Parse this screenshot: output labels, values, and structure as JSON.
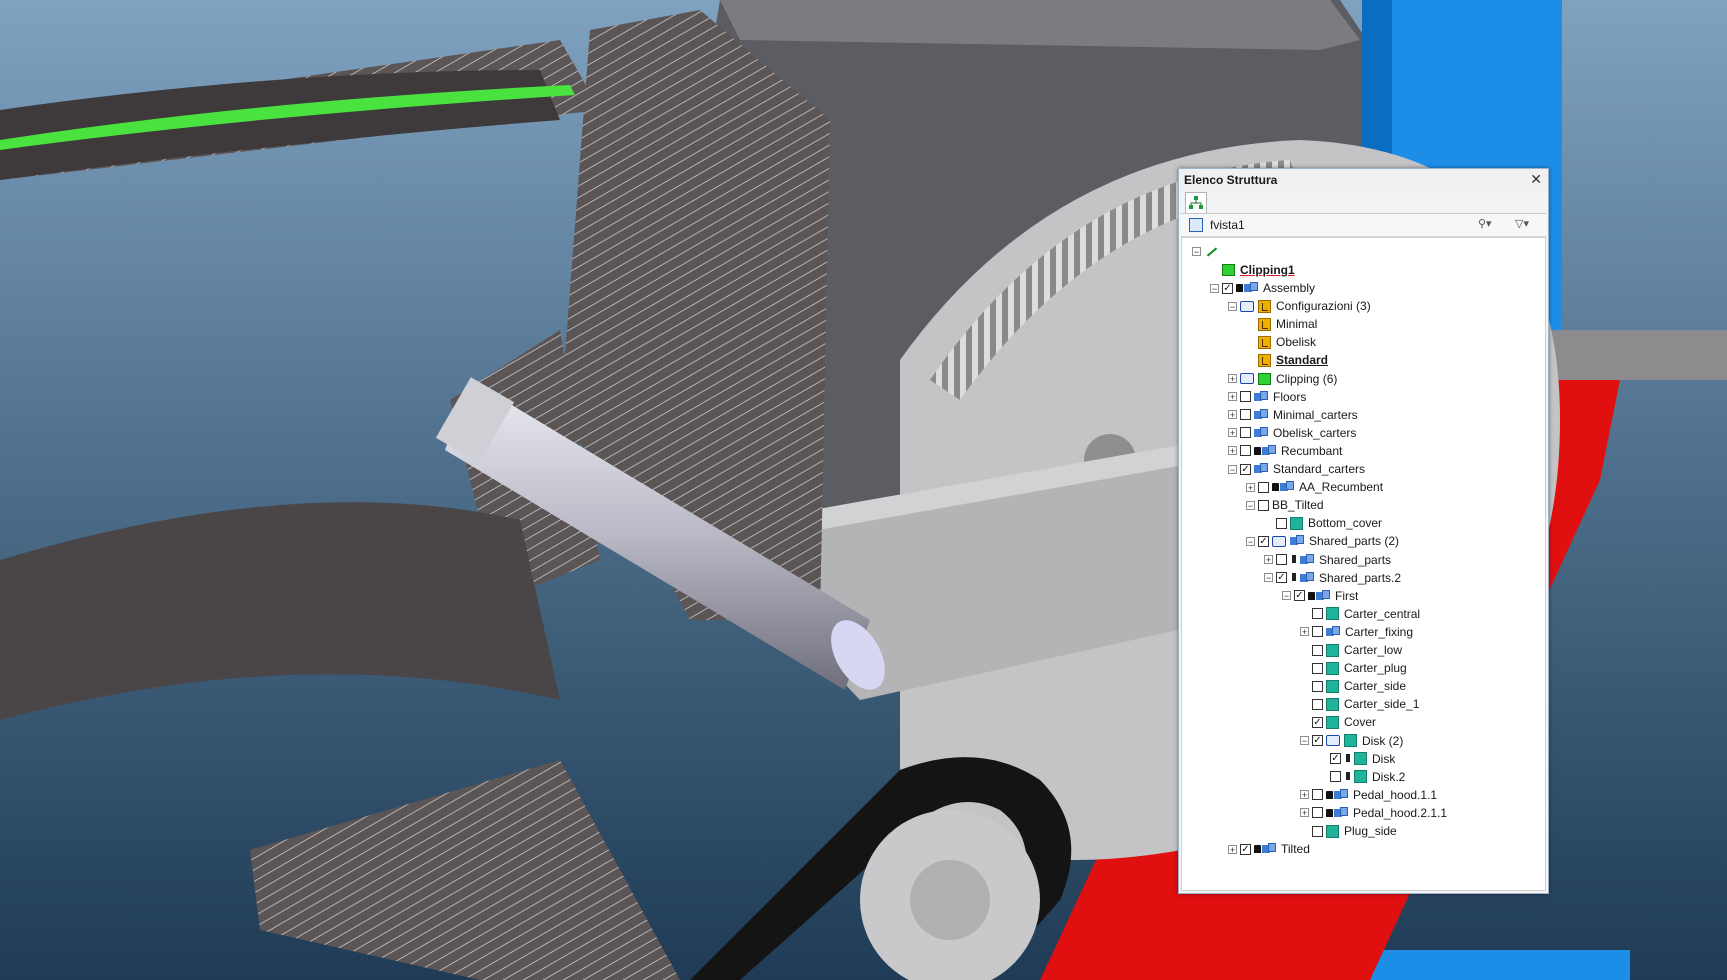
{
  "panel": {
    "title": "Elenco Struttura",
    "close_glyph": "✕",
    "view_name": "fvista1",
    "icons": {
      "search": "binoculars-icon",
      "filter": "filter-icon",
      "tab": "structure-tree-icon"
    }
  },
  "tree": {
    "items": [
      {
        "label": "",
        "level": 0,
        "expander": "-",
        "checkbox": "none",
        "icon": "line",
        "bold": false
      },
      {
        "label": "Clipping1",
        "level": 1,
        "expander": "none",
        "checkbox": "none",
        "icon": "clip",
        "bold": true
      },
      {
        "label": "Assembly",
        "level": 1,
        "expander": "-",
        "checkbox": "checked",
        "lock": true,
        "icon": "cubes",
        "bold": false
      },
      {
        "label": "Configurazioni (3)",
        "level": 2,
        "expander": "-",
        "checkbox": "none",
        "icon": "folder-conf",
        "bold": false
      },
      {
        "label": "Minimal",
        "level": 3,
        "expander": "none",
        "checkbox": "none",
        "icon": "conf",
        "bold": false
      },
      {
        "label": "Obelisk",
        "level": 3,
        "expander": "none",
        "checkbox": "none",
        "icon": "conf",
        "bold": false
      },
      {
        "label": "Standard",
        "level": 3,
        "expander": "none",
        "checkbox": "none",
        "icon": "conf",
        "bold": true
      },
      {
        "label": "Clipping (6)",
        "level": 2,
        "expander": "+",
        "checkbox": "none",
        "icon": "folder-clip",
        "bold": false
      },
      {
        "label": "Floors",
        "level": 2,
        "expander": "+",
        "checkbox": "empty",
        "icon": "cubes",
        "bold": false
      },
      {
        "label": "Minimal_carters",
        "level": 2,
        "expander": "+",
        "checkbox": "empty",
        "icon": "cubes",
        "bold": false
      },
      {
        "label": "Obelisk_carters",
        "level": 2,
        "expander": "+",
        "checkbox": "empty",
        "icon": "cubes",
        "bold": false
      },
      {
        "label": "Recumbant",
        "level": 2,
        "expander": "+",
        "checkbox": "empty",
        "lock": true,
        "icon": "cubes",
        "bold": false
      },
      {
        "label": "Standard_carters",
        "level": 2,
        "expander": "-",
        "checkbox": "checked",
        "icon": "cubes",
        "bold": false
      },
      {
        "label": "AA_Recumbent",
        "level": 3,
        "expander": "+",
        "checkbox": "empty",
        "lock": true,
        "icon": "cubes",
        "bold": false
      },
      {
        "label": "BB_Tilted",
        "level": 3,
        "expander": "-",
        "checkbox": "empty",
        "icon": "none",
        "bold": false
      },
      {
        "label": "Bottom_cover",
        "level": 4,
        "expander": "none",
        "checkbox": "empty",
        "icon": "part",
        "bold": false
      },
      {
        "label": "Shared_parts (2)",
        "level": 3,
        "expander": "-",
        "checkbox": "checked",
        "icon": "folder-cubes",
        "bold": false
      },
      {
        "label": "Shared_parts",
        "level": 4,
        "expander": "+",
        "checkbox": "empty",
        "pin": true,
        "icon": "cubes",
        "bold": false
      },
      {
        "label": "Shared_parts.2",
        "level": 4,
        "expander": "-",
        "checkbox": "checked",
        "pin": true,
        "icon": "cubes",
        "bold": false
      },
      {
        "label": "First",
        "level": 5,
        "expander": "-",
        "checkbox": "checked",
        "lock": true,
        "icon": "cubes",
        "bold": false
      },
      {
        "label": "Carter_central",
        "level": 6,
        "expander": "none",
        "checkbox": "empty",
        "icon": "part",
        "bold": false
      },
      {
        "label": "Carter_fixing",
        "level": 6,
        "expander": "+",
        "checkbox": "empty",
        "icon": "cubes",
        "bold": false
      },
      {
        "label": "Carter_low",
        "level": 6,
        "expander": "none",
        "checkbox": "empty",
        "icon": "part",
        "bold": false
      },
      {
        "label": "Carter_plug",
        "level": 6,
        "expander": "none",
        "checkbox": "empty",
        "icon": "part",
        "bold": false
      },
      {
        "label": "Carter_side",
        "level": 6,
        "expander": "none",
        "checkbox": "empty",
        "icon": "part",
        "bold": false
      },
      {
        "label": "Carter_side_1",
        "level": 6,
        "expander": "none",
        "checkbox": "empty",
        "icon": "part",
        "bold": false
      },
      {
        "label": "Cover",
        "level": 6,
        "expander": "none",
        "checkbox": "checked",
        "icon": "part",
        "bold": false
      },
      {
        "label": "Disk (2)",
        "level": 6,
        "expander": "-",
        "checkbox": "checked",
        "icon": "folder-part",
        "bold": false
      },
      {
        "label": "Disk",
        "level": 7,
        "expander": "none",
        "checkbox": "checked",
        "pin": true,
        "icon": "part",
        "bold": false
      },
      {
        "label": "Disk.2",
        "level": 7,
        "expander": "none",
        "checkbox": "empty",
        "pin": true,
        "icon": "part",
        "bold": false
      },
      {
        "label": "Pedal_hood.1.1",
        "level": 6,
        "expander": "+",
        "checkbox": "empty",
        "lock": true,
        "icon": "cubes",
        "bold": false
      },
      {
        "label": "Pedal_hood.2.1.1",
        "level": 6,
        "expander": "+",
        "checkbox": "empty",
        "lock": true,
        "icon": "cubes",
        "bold": false
      },
      {
        "label": "Plug_side",
        "level": 6,
        "expander": "none",
        "checkbox": "empty",
        "icon": "part",
        "bold": false
      },
      {
        "label": "Tilted",
        "level": 2,
        "expander": "+",
        "checkbox": "checked",
        "lock": true,
        "icon": "cubes",
        "bold": false
      }
    ]
  },
  "colors": {
    "background_top": "#7fa2c0",
    "background_bottom": "#1f3b55",
    "accent_blue": "#1d8ee8",
    "accent_red": "#e01010",
    "green_belt": "#49e23f",
    "part_gray": "#a9a9aa"
  }
}
